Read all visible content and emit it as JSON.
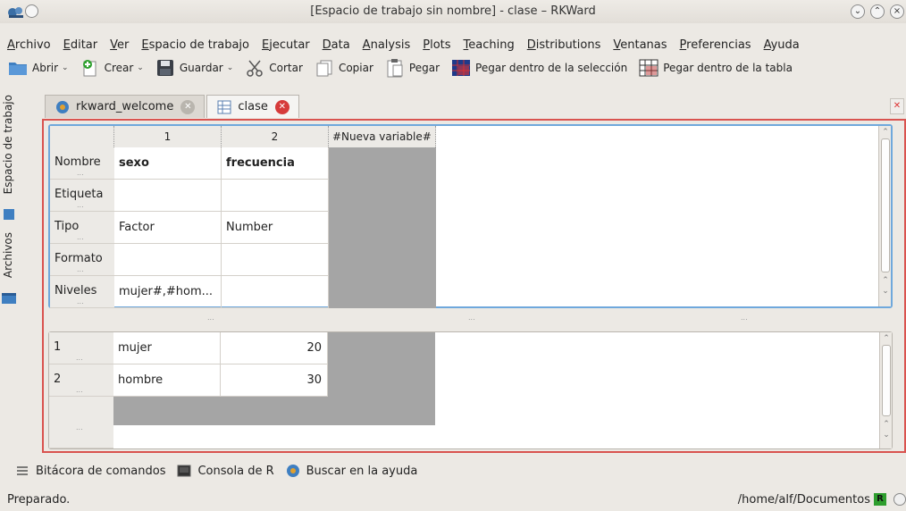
{
  "window": {
    "title": "[Espacio de trabajo sin nombre] - clase – RKWard",
    "buttons": [
      "⌄",
      "⌃",
      "×"
    ]
  },
  "menu": [
    "Archivo",
    "Editar",
    "Ver",
    "Espacio de trabajo",
    "Ejecutar",
    "Data",
    "Analysis",
    "Plots",
    "Teaching",
    "Distributions",
    "Ventanas",
    "Preferencias",
    "Ayuda"
  ],
  "toolbar": {
    "abrir": "Abrir",
    "crear": "Crear",
    "guardar": "Guardar",
    "cortar": "Cortar",
    "copiar": "Copiar",
    "pegar": "Pegar",
    "pegar_seleccion": "Pegar dentro de la selección",
    "pegar_tabla": "Pegar dentro de la tabla"
  },
  "left_dock": {
    "workspace_tab": "Espacio de trabajo",
    "files_tab": "Archivos"
  },
  "tabs": [
    {
      "label": "rkward_welcome"
    },
    {
      "label": "clase"
    }
  ],
  "editor": {
    "columns": [
      "1",
      "2",
      "#Nueva variable#"
    ],
    "meta_rows": [
      {
        "label": "Nombre",
        "values": [
          "sexo",
          "frecuencia"
        ]
      },
      {
        "label": "Etiqueta",
        "values": [
          "",
          ""
        ]
      },
      {
        "label": "Tipo",
        "values": [
          "Factor",
          "Number"
        ]
      },
      {
        "label": "Formato",
        "values": [
          "",
          ""
        ]
      },
      {
        "label": "Niveles",
        "values": [
          "mujer#,#hom...",
          ""
        ]
      }
    ],
    "data_rows": [
      {
        "index": "1",
        "values": [
          "mujer",
          "20"
        ]
      },
      {
        "index": "2",
        "values": [
          "hombre",
          "30"
        ]
      }
    ],
    "dots": "..."
  },
  "bottom_dock": {
    "log": "Bitácora de comandos",
    "console": "Consola de R",
    "help": "Buscar en la ayuda"
  },
  "status": {
    "text": "Preparado.",
    "path": "/home/alf/Documentos",
    "r_label": "R"
  },
  "colors": {
    "editor_border": "#d9534f",
    "meta_border": "#6fa8dc",
    "empty_column": "#a5a5a5"
  }
}
